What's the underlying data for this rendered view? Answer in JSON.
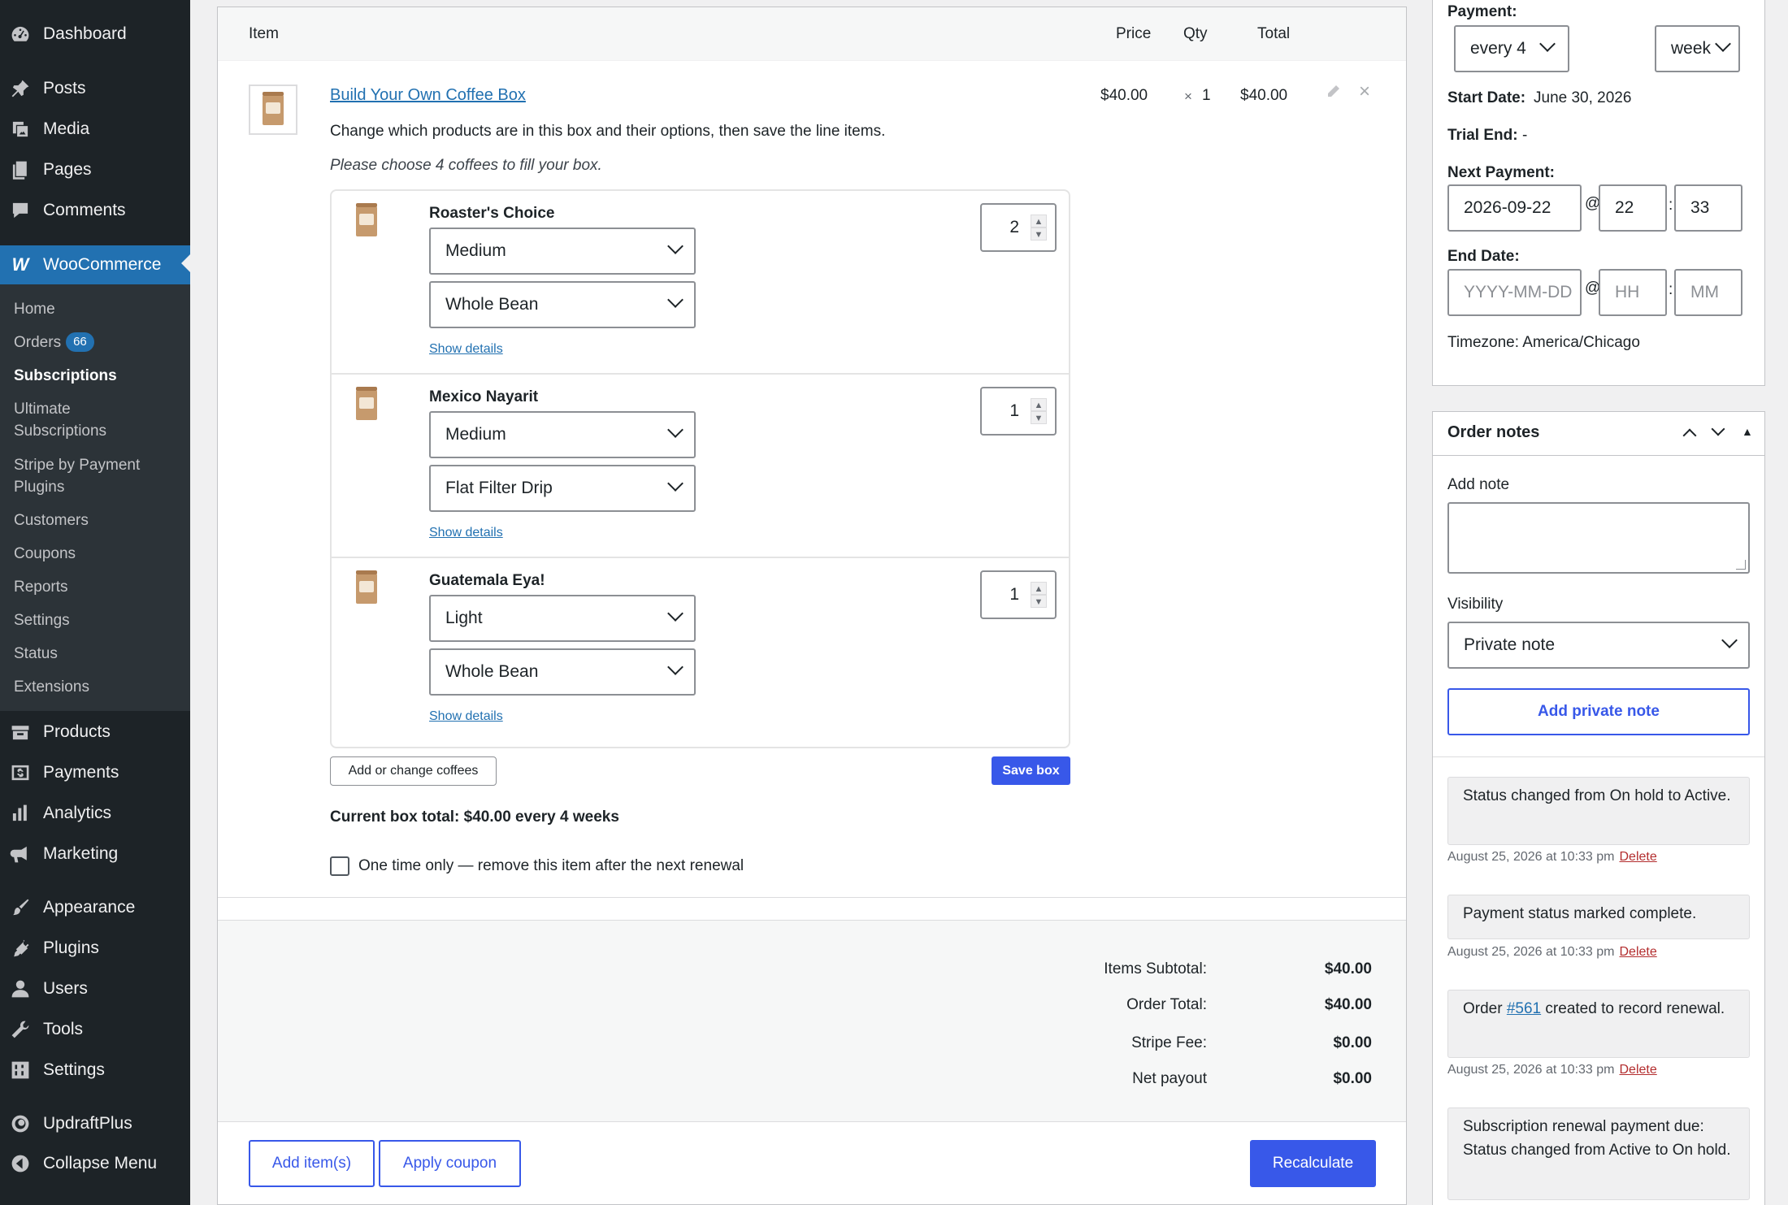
{
  "sidebar": {
    "menu": {
      "dashboard": "Dashboard",
      "posts": "Posts",
      "media": "Media",
      "pages": "Pages",
      "comments": "Comments",
      "woocommerce": "WooCommerce",
      "products": "Products",
      "payments": "Payments",
      "analytics": "Analytics",
      "marketing": "Marketing",
      "appearance": "Appearance",
      "plugins": "Plugins",
      "users": "Users",
      "tools": "Tools",
      "settings": "Settings",
      "updraftplus": "UpdraftPlus",
      "collapse": "Collapse Menu"
    },
    "submenu": {
      "home": "Home",
      "orders": "Orders",
      "orders_count": "66",
      "subscriptions": "Subscriptions",
      "ultimate_1": "Ultimate",
      "ultimate_2": "Subscriptions",
      "stripe_1": "Stripe by Payment",
      "stripe_2": "Plugins",
      "customers": "Customers",
      "coupons": "Coupons",
      "reports": "Reports",
      "settings": "Settings",
      "status": "Status",
      "extensions": "Extensions"
    }
  },
  "items": {
    "headers": {
      "item": "Item",
      "price": "Price",
      "qty": "Qty",
      "total": "Total"
    },
    "line_item": {
      "name": "Build Your Own Coffee Box",
      "price": "$40.00",
      "qty_x": "×",
      "qty": "1",
      "total": "$40.00",
      "description": "Change which products are in this box and their options, then save the line items.",
      "instruction": "Please choose 4 coffees to fill your box."
    },
    "box_products": [
      {
        "name": "Roaster's Choice",
        "roast": "Medium",
        "grind": "Whole Bean",
        "qty": "2",
        "details": "Show details"
      },
      {
        "name": "Mexico Nayarit",
        "roast": "Medium",
        "grind": "Flat Filter Drip",
        "qty": "1",
        "details": "Show details"
      },
      {
        "name": "Guatemala Eya!",
        "roast": "Light",
        "grind": "Whole Bean",
        "qty": "1",
        "details": "Show details"
      }
    ],
    "add_change_label": "Add or change coffees",
    "save_box_label": "Save box",
    "box_total": "Current box total: $40.00 every 4 weeks",
    "one_time_label": "One time only — remove this item after the next renewal",
    "one_time_checked": false,
    "totals": [
      {
        "label": "Items Subtotal:",
        "value": "$40.00"
      },
      {
        "label": "Order Total:",
        "value": "$40.00"
      },
      {
        "label": "Stripe Fee:",
        "value": "$0.00"
      },
      {
        "label": "Net payout",
        "value": "$0.00"
      }
    ],
    "add_items_label": "Add item(s)",
    "apply_coupon_label": "Apply coupon",
    "recalculate_label": "Recalculate"
  },
  "schedule": {
    "payment_label": "Payment:",
    "interval": "every 4",
    "period": "week",
    "start_label": "Start Date:",
    "start_value": "June 30, 2026",
    "trial_label": "Trial End:",
    "trial_value": "-",
    "next_label": "Next Payment:",
    "next_date": "2026-09-22",
    "next_hour": "22",
    "next_minute": "33",
    "at": "@",
    "colon": ":",
    "end_label": "End Date:",
    "end_date_placeholder": "YYYY-MM-DD",
    "end_hour_placeholder": "HH",
    "end_minute_placeholder": "MM",
    "timezone": "Timezone: America/Chicago"
  },
  "notes": {
    "title": "Order notes",
    "add_note_label": "Add note",
    "visibility_label": "Visibility",
    "visibility_value": "Private note",
    "add_button": "Add private note",
    "entries": [
      {
        "text": "Status changed from On hold to Active.",
        "meta": "August 25, 2026 at 10:33 pm",
        "delete": "Delete"
      },
      {
        "text": "Payment status marked complete.",
        "meta": "August 25, 2026 at 10:33 pm",
        "delete": "Delete"
      },
      {
        "prefix": "Order ",
        "link": "#561",
        "suffix": " created to record renewal.",
        "meta": "August 25, 2026 at 10:33 pm",
        "delete": "Delete"
      },
      {
        "text": "Subscription renewal payment due: Status changed from Active to On hold."
      }
    ]
  },
  "colors": {
    "accent": "#3858e9",
    "wp_blue": "#2271b1",
    "sidebar": "#1d2327",
    "submenu": "#2c3338",
    "delete": "#b32d2e"
  }
}
